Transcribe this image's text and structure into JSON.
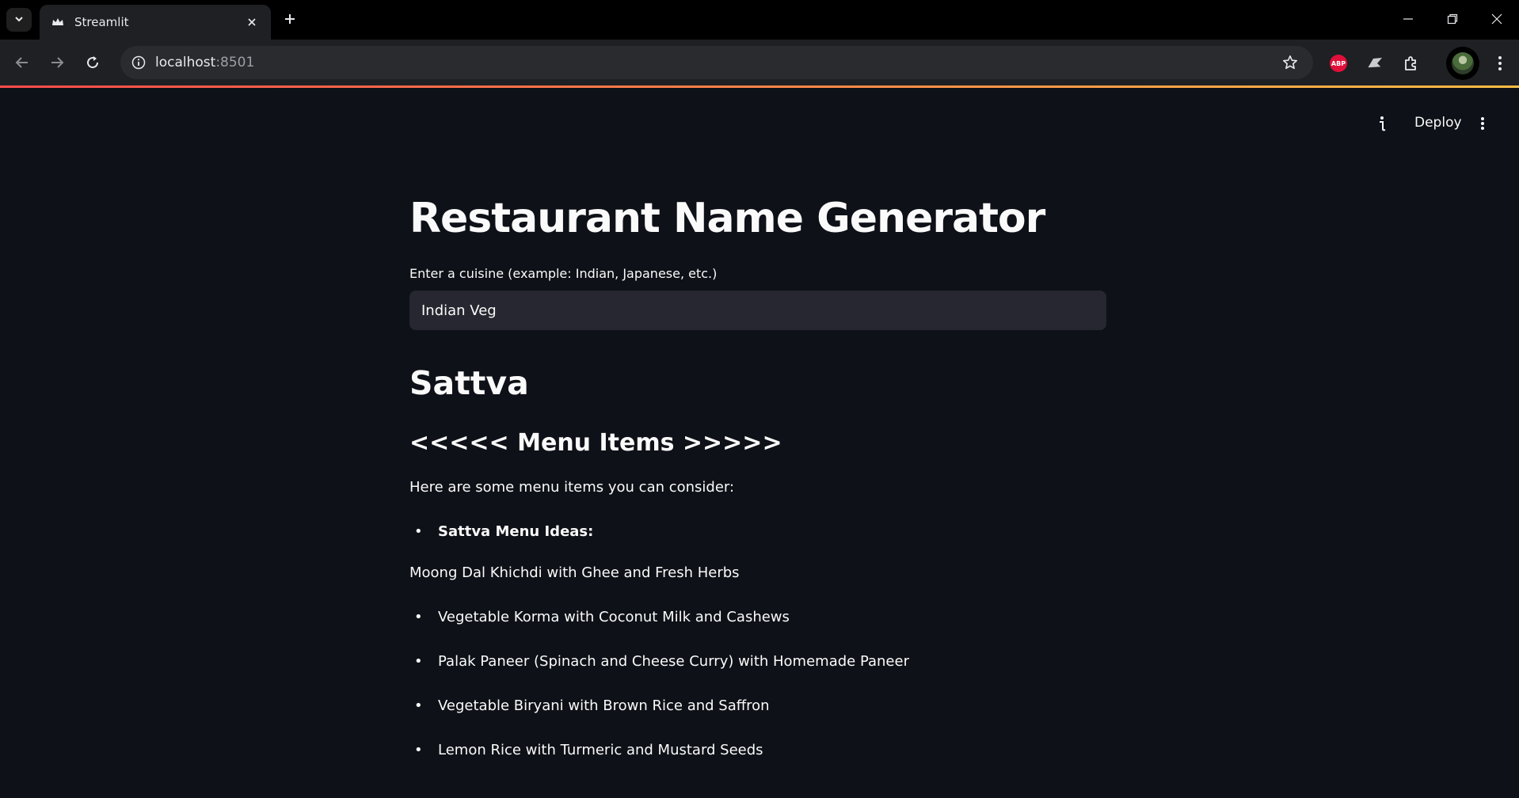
{
  "browser": {
    "tab_title": "Streamlit",
    "url_host": "localhost",
    "url_port": ":8501",
    "extensions": {
      "abp_label": "ABP"
    }
  },
  "header": {
    "deploy_label": "Deploy"
  },
  "app": {
    "title": "Restaurant Name Generator",
    "input_label": "Enter a cuisine (example: Indian, Japanese, etc.)",
    "input_value": "Indian Veg",
    "restaurant_name": "Sattva",
    "menu_heading": "<<<<< Menu Items >>>>>",
    "intro": "Here are some menu items you can consider:",
    "menu_ideas_heading": "Sattva Menu Ideas:",
    "plain_item": "Moong Dal Khichdi with Ghee and Fresh Herbs",
    "menu_items": [
      "Vegetable Korma with Coconut Milk and Cashews",
      "Palak Paneer (Spinach and Cheese Curry) with Homemade Paneer",
      "Vegetable Biryani with Brown Rice and Saffron",
      "Lemon Rice with Turmeric and Mustard Seeds"
    ]
  },
  "colors": {
    "background": "#0e1117",
    "input_bg": "#262730",
    "text": "#fafafa",
    "accent_gradient_start": "#ff4b4b",
    "accent_gradient_end": "#ffbd45"
  }
}
